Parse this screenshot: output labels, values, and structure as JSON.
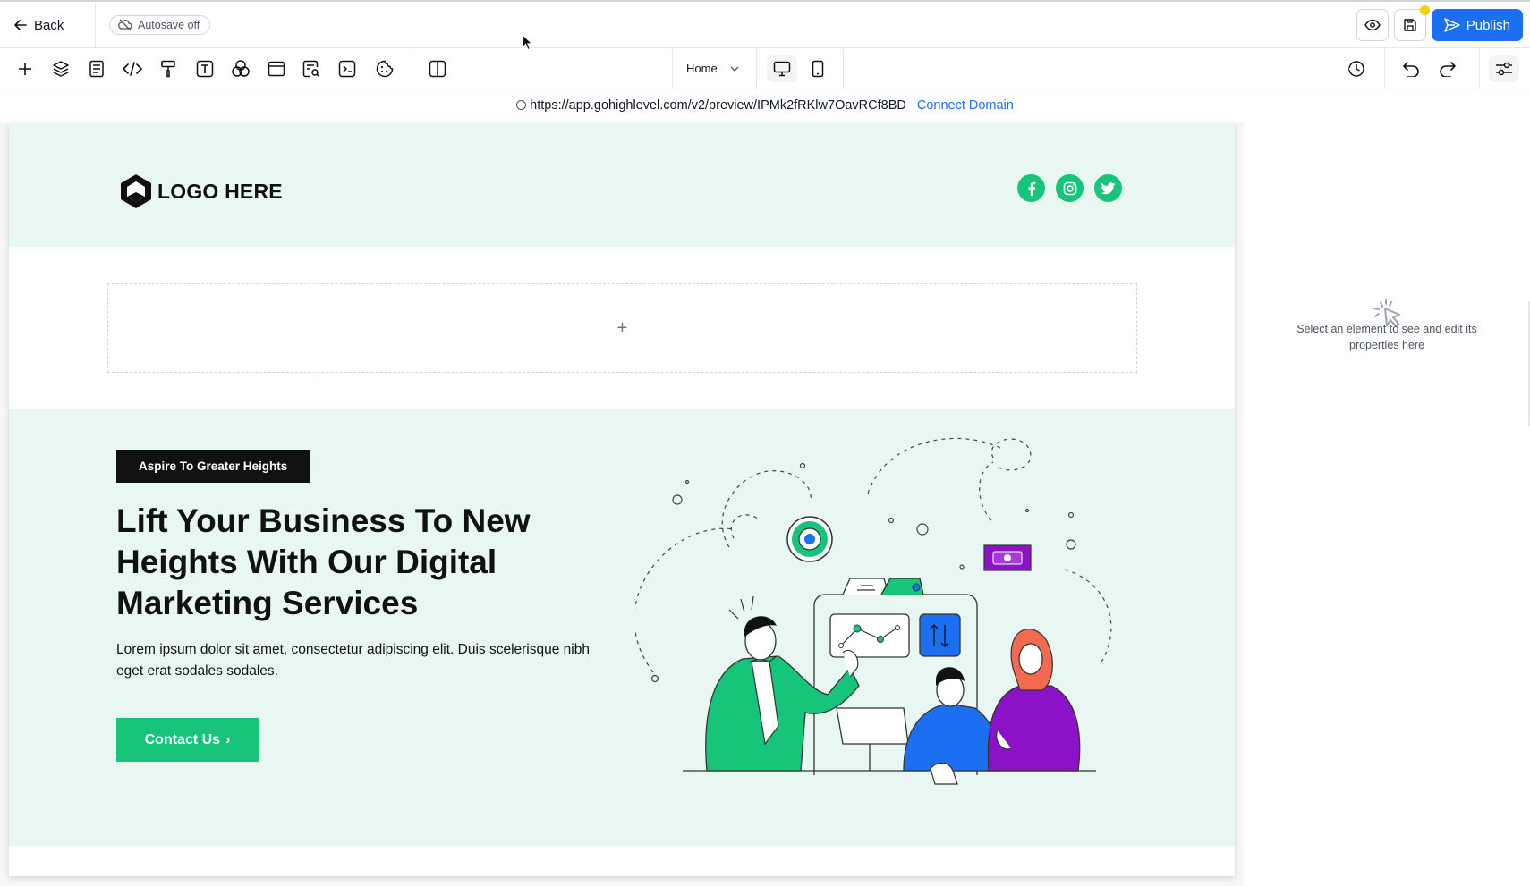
{
  "topbar": {
    "back_label": "Back",
    "autosave_label": "Autosave off",
    "publish_label": "Publish"
  },
  "toolbar": {
    "page_select": "Home",
    "tools": [
      "plus-icon",
      "layers-icon",
      "page-icon",
      "code-icon",
      "paint-roller-icon",
      "text-icon",
      "shapes-icon",
      "browser-icon",
      "form-search-icon",
      "terminal-icon",
      "cookie-icon",
      "split-view-icon"
    ]
  },
  "urlbar": {
    "url": "https://app.gohighlevel.com/v2/preview/IPMk2fRKlw7OavRCf8BD",
    "connect_label": "Connect Domain"
  },
  "page": {
    "logo_text": "LOGO HERE",
    "dropzone_symbol": "+",
    "hero": {
      "tag": "Aspire To Greater Heights",
      "title": "Lift Your Business To New Heights With Our Digital Marketing Services",
      "text": "Lorem ipsum dolor sit amet, consectetur adipiscing elit. Duis scelerisque nibh eget erat sodales sodales.",
      "cta_label": "Contact Us",
      "cta_arrow": "›"
    },
    "colors": {
      "accent": "#16c47a",
      "hero_bg": "#e8f7f1",
      "tag_bg": "#111111",
      "blue": "#1d6ff2",
      "purple": "#8b12c7"
    }
  },
  "right_panel": {
    "empty_text": "Select an element to see and edit its properties here"
  }
}
